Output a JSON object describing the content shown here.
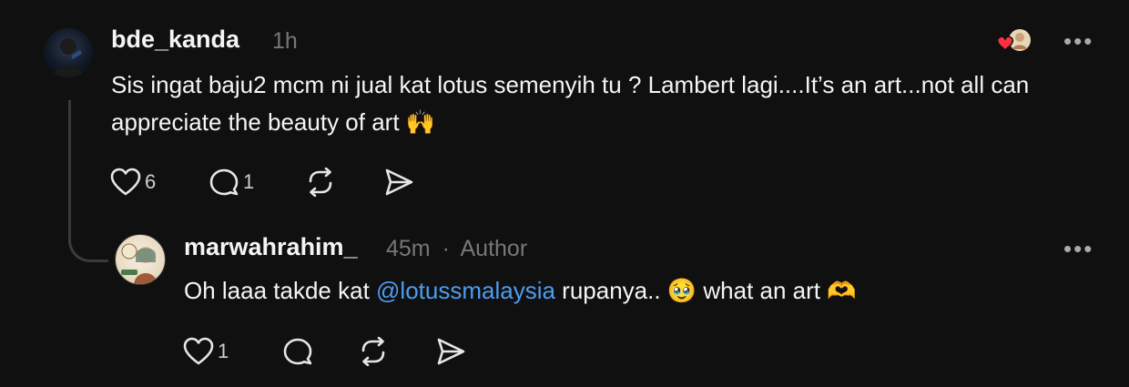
{
  "comments": [
    {
      "username": "bde_kanda",
      "time": "1h",
      "text": "Sis ingat baju2 mcm ni jual kat lotus semenyih tu ? Lambert lagi....It’s an art...not all can appreciate the beauty of art 🙌",
      "likes": "6",
      "replies": "1",
      "more": "•••"
    },
    {
      "username": "marwahrahim_",
      "time": "45m",
      "separator": "·",
      "badge": "Author",
      "text_before": "Oh laaa takde kat ",
      "mention": "@lotussmalaysia",
      "text_after": " rupanya.. 🥹 what an art 🫶",
      "likes": "1",
      "more": "•••"
    }
  ],
  "icons": {
    "like": "heart-icon",
    "reply": "comment-icon",
    "repost": "repost-icon",
    "share": "send-icon",
    "liked_by_author": "heart-avatar-badge-icon"
  },
  "colors": {
    "background": "#101010",
    "text": "#f3f5f7",
    "secondary": "#777777",
    "mention": "#4c9df0",
    "heart": "#ff3040"
  }
}
